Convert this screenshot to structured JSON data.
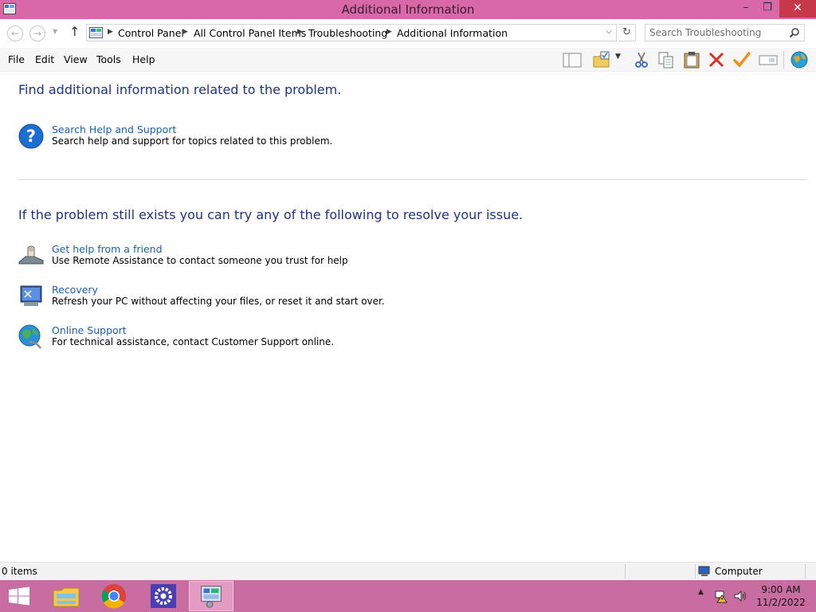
{
  "window": {
    "title": "Additional Information",
    "controls": {
      "minimize": "–",
      "maximize": "❐",
      "close": "✕"
    }
  },
  "navigation": {
    "breadcrumb": [
      "Control Panel",
      "All Control Panel Items",
      "Troubleshooting",
      "Additional Information"
    ],
    "search_placeholder": "Search Troubleshooting"
  },
  "menu": [
    "File",
    "Edit",
    "View",
    "Tools",
    "Help"
  ],
  "toolbar_icons": [
    "layout-icon",
    "folder-properties-icon",
    "cut-icon",
    "copy-icon",
    "paste-icon",
    "delete-icon",
    "check-icon",
    "rename-icon",
    "globe-icon"
  ],
  "content": {
    "section1": {
      "heading": "Find additional information related to the problem.",
      "items": [
        {
          "title": "Search Help and Support",
          "description": "Search help and support for topics related to this problem.",
          "icon": "help-icon"
        }
      ]
    },
    "section2": {
      "heading": "If the problem still exists you can try any of the following to resolve your issue.",
      "items": [
        {
          "title": "Get help from a friend",
          "description": "Use Remote Assistance to contact someone you trust for help",
          "icon": "remote-assistance-icon"
        },
        {
          "title": "Recovery",
          "description": "Refresh your PC without affecting your files, or reset it and start over.",
          "icon": "recovery-icon"
        },
        {
          "title": "Online Support",
          "description": "For technical assistance, contact Customer Support online.",
          "icon": "online-support-icon"
        }
      ]
    }
  },
  "status": {
    "item_count": "0 items",
    "zone": "Computer"
  },
  "taskbar": {
    "apps": [
      "start-icon",
      "file-explorer-icon",
      "chrome-icon",
      "settings-icon",
      "control-panel-icon"
    ],
    "clock": {
      "time": "9:00 AM",
      "date": "11/2/2022"
    }
  },
  "colors": {
    "title_bar": "#d868a8",
    "close_button": "#c7394a",
    "heading": "#1e3287",
    "link": "#1a5fb4",
    "taskbar": "#c96ca1"
  }
}
